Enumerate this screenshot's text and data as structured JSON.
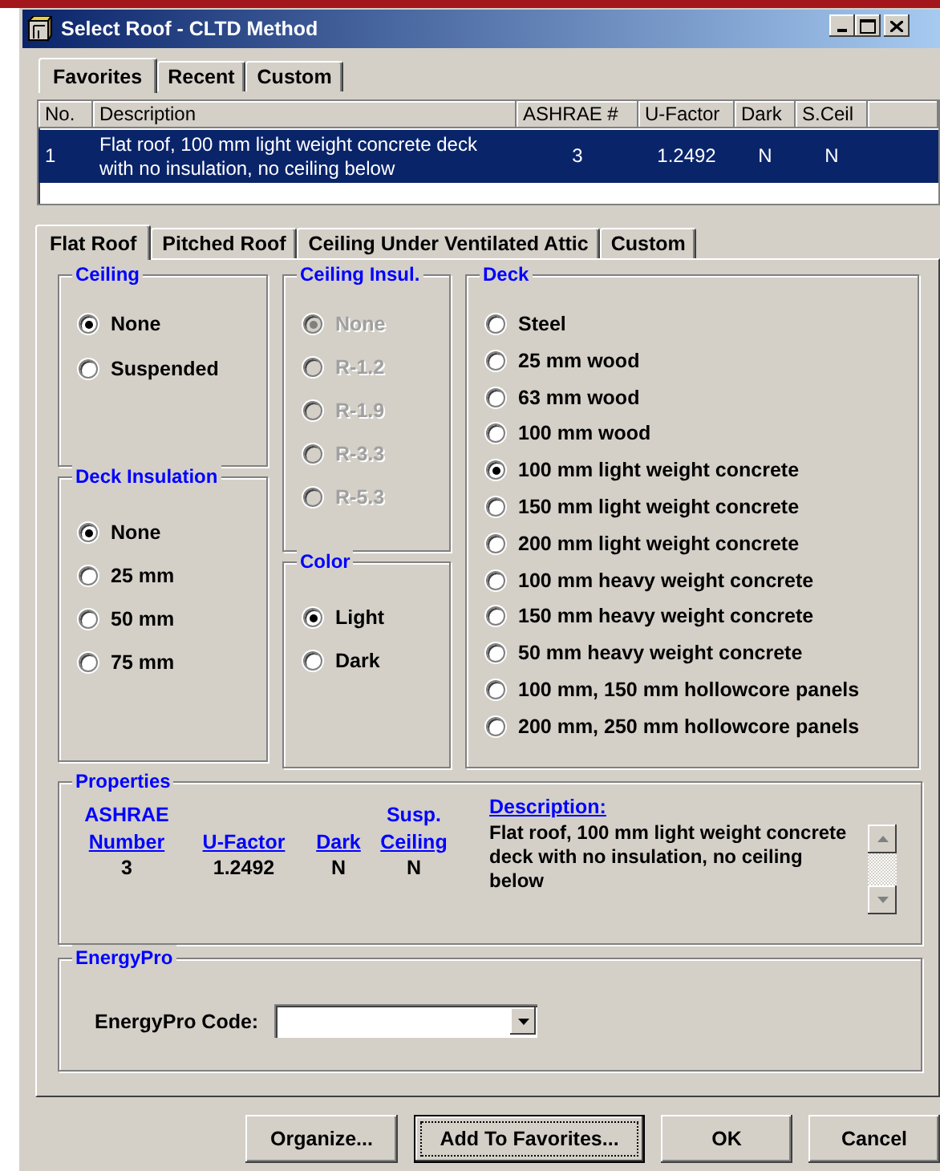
{
  "window": {
    "title": "Select Roof - CLTD Method"
  },
  "list_tabs": [
    {
      "label": "Favorites",
      "selected": true
    },
    {
      "label": "Recent",
      "selected": false
    },
    {
      "label": "Custom",
      "selected": false
    }
  ],
  "favorites_table": {
    "columns": [
      "No.",
      "Description",
      "ASHRAE #",
      "U-Factor",
      "Dark",
      "S.Ceil"
    ],
    "rows": [
      {
        "cells": [
          "1",
          "Flat roof, 100 mm light weight concrete deck with no insulation, no ceiling below",
          "3",
          "1.2492",
          "N",
          "N"
        ],
        "selected": true
      }
    ]
  },
  "roof_tabs": [
    {
      "label": "Flat Roof",
      "selected": true
    },
    {
      "label": "Pitched Roof",
      "selected": false
    },
    {
      "label": "Ceiling Under Ventilated Attic",
      "selected": false
    },
    {
      "label": "Custom",
      "selected": false
    }
  ],
  "ceiling": {
    "title": "Ceiling",
    "options": [
      {
        "label": "None",
        "selected": true
      },
      {
        "label": "Suspended",
        "selected": false
      }
    ]
  },
  "ceiling_insulation": {
    "title": "Ceiling Insul.",
    "disabled": true,
    "options": [
      {
        "label": "None",
        "selected": true
      },
      {
        "label": "R-1.2",
        "selected": false
      },
      {
        "label": "R-1.9",
        "selected": false
      },
      {
        "label": "R-3.3",
        "selected": false
      },
      {
        "label": "R-5.3",
        "selected": false
      }
    ]
  },
  "deck": {
    "title": "Deck",
    "options": [
      {
        "label": "Steel",
        "selected": false
      },
      {
        "label": "25 mm wood",
        "selected": false
      },
      {
        "label": "63 mm wood",
        "selected": false
      },
      {
        "label": "100 mm wood",
        "selected": false
      },
      {
        "label": "100 mm light weight concrete",
        "selected": true
      },
      {
        "label": "150 mm light weight concrete",
        "selected": false
      },
      {
        "label": "200 mm light weight concrete",
        "selected": false
      },
      {
        "label": "100 mm heavy weight concrete",
        "selected": false
      },
      {
        "label": "150 mm heavy weight concrete",
        "selected": false
      },
      {
        "label": "50 mm heavy weight concrete",
        "selected": false
      },
      {
        "label": "100 mm, 150 mm hollowcore panels",
        "selected": false
      },
      {
        "label": "200 mm, 250 mm hollowcore panels",
        "selected": false
      }
    ]
  },
  "deck_insulation": {
    "title": "Deck Insulation",
    "options": [
      {
        "label": "None",
        "selected": true
      },
      {
        "label": "25 mm",
        "selected": false
      },
      {
        "label": "50 mm",
        "selected": false
      },
      {
        "label": "75 mm",
        "selected": false
      }
    ]
  },
  "color": {
    "title": "Color",
    "options": [
      {
        "label": "Light",
        "selected": true
      },
      {
        "label": "Dark",
        "selected": false
      }
    ]
  },
  "properties": {
    "title": "Properties",
    "columns": [
      {
        "heading": [
          "ASHRAE",
          "Number"
        ],
        "value": "3"
      },
      {
        "heading": [
          "U-Factor"
        ],
        "value": "1.2492"
      },
      {
        "heading": [
          "Dark"
        ],
        "value": "N"
      },
      {
        "heading": [
          "Susp.",
          "Ceiling"
        ],
        "value": "N"
      }
    ],
    "description_label": "Description:",
    "description": "Flat roof, 100 mm light weight concrete deck with no insulation, no ceiling below"
  },
  "energypro": {
    "title": "EnergyPro",
    "label": "EnergyPro Code:"
  },
  "buttons": [
    {
      "label": "Organize...",
      "focused": false
    },
    {
      "label": "Add To Favorites...",
      "focused": true
    },
    {
      "label": "OK",
      "focused": false
    },
    {
      "label": "Cancel",
      "focused": false
    }
  ]
}
